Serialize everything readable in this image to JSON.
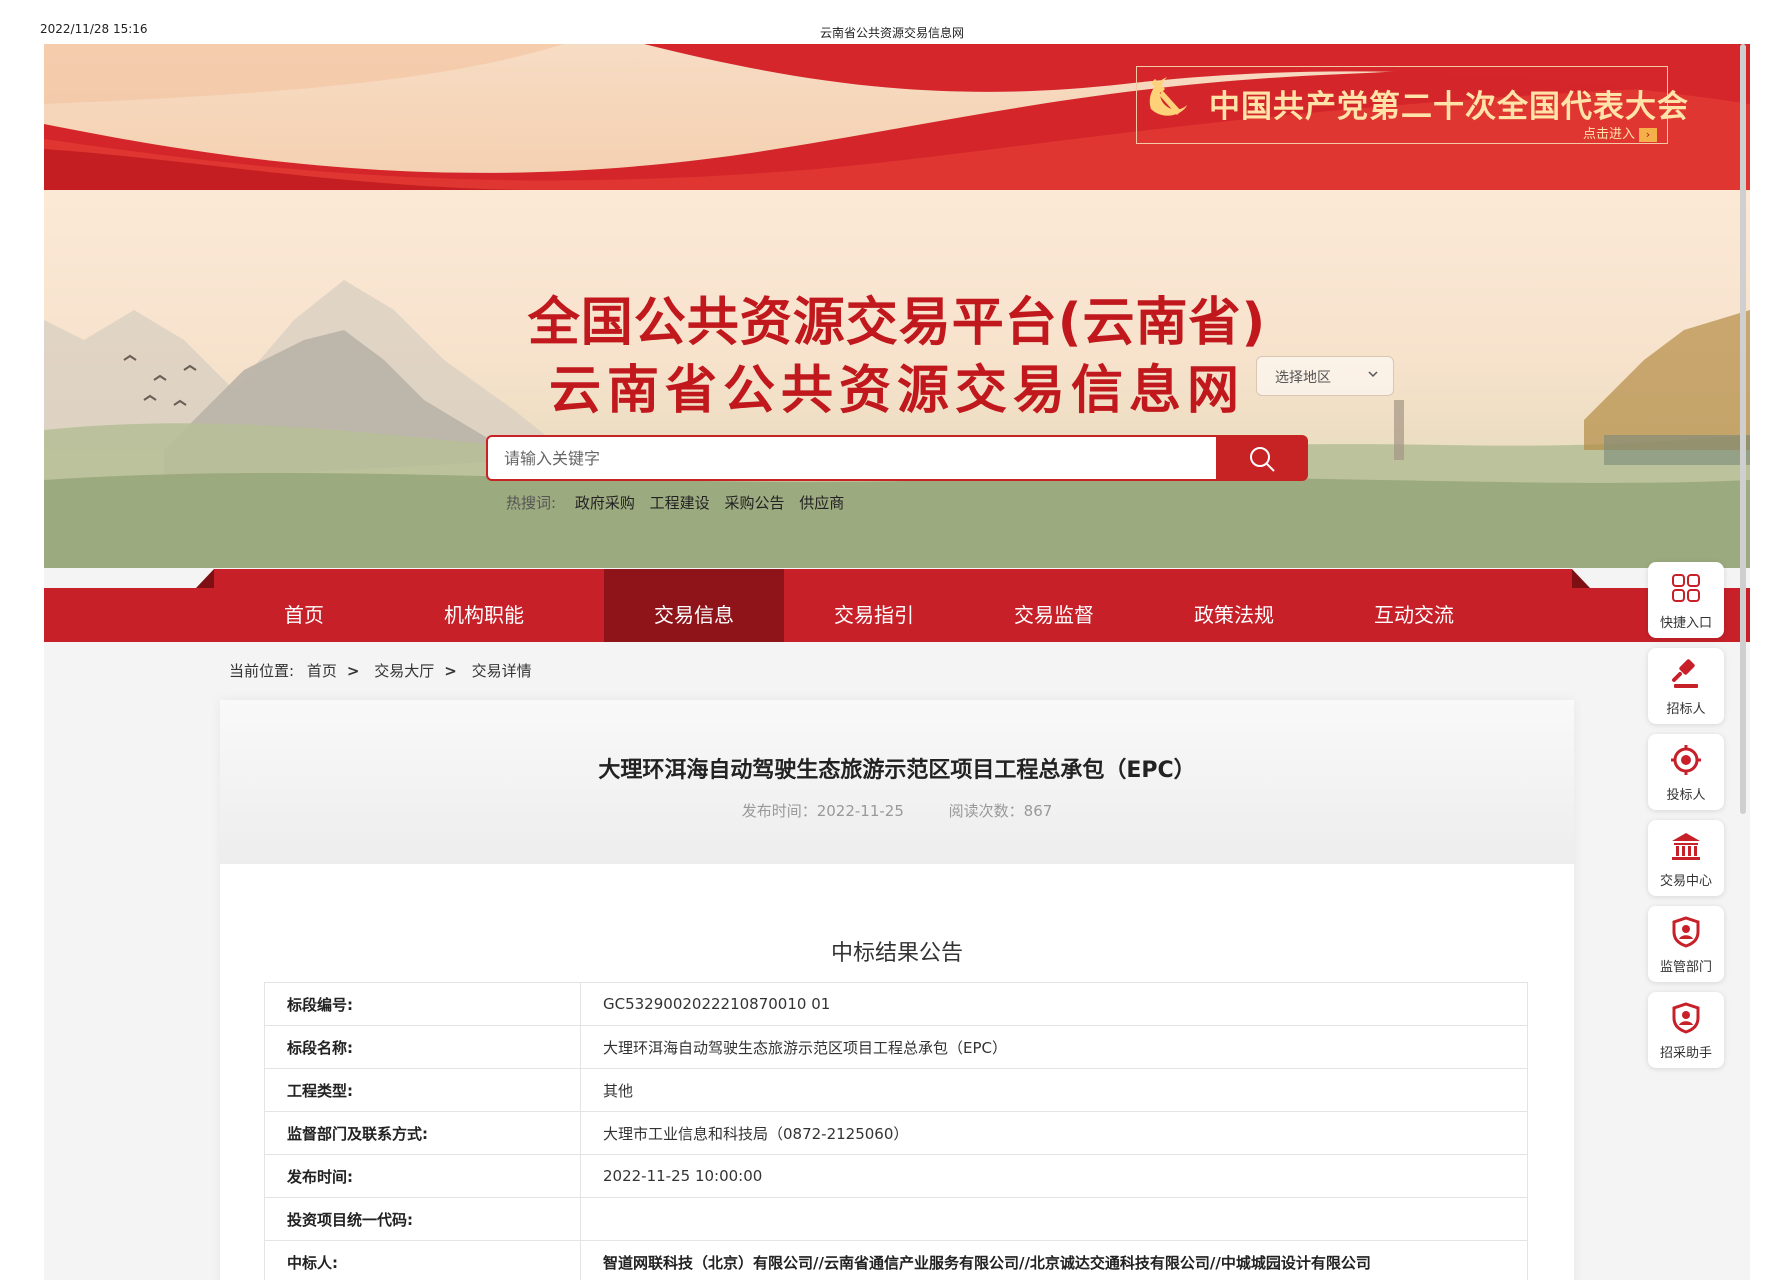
{
  "print_header": {
    "datetime": "2022/11/28 15:16",
    "page_title": "云南省公共资源交易信息网"
  },
  "banner": {
    "congress_text": "中国共产党第二十次全国代表大会",
    "enter_label": "点击进入"
  },
  "header": {
    "title_line1": "全国公共资源交易平台(云南省)",
    "title_line2": "云南省公共资源交易信息网",
    "region_select": "选择地区"
  },
  "search": {
    "placeholder": "请输入关键字",
    "hot_label": "热搜词:",
    "hot_words": [
      "政府采购",
      "工程建设",
      "采购公告",
      "供应商"
    ]
  },
  "nav": {
    "items": [
      "首页",
      "机构职能",
      "交易信息",
      "交易指引",
      "交易监督",
      "政策法规",
      "互动交流"
    ],
    "active_index": 2
  },
  "breadcrumb": {
    "label": "当前位置:",
    "items": [
      "首页",
      "交易大厅",
      "交易详情"
    ]
  },
  "document": {
    "title": "大理环洱海自动驾驶生态旅游示范区项目工程总承包（EPC）",
    "publish_time": "发布时间：2022-11-25",
    "read_count": "阅读次数：867",
    "section_title": "中标结果公告",
    "rows": [
      {
        "key": "标段编号:",
        "value": "GC5329002022210870010 01"
      },
      {
        "key": "标段名称:",
        "value": "大理环洱海自动驾驶生态旅游示范区项目工程总承包（EPC）"
      },
      {
        "key": "工程类型:",
        "value": "其他"
      },
      {
        "key": "监督部门及联系方式:",
        "value": "大理市工业信息和科技局（0872-2125060）"
      },
      {
        "key": "发布时间:",
        "value": "2022-11-25 10:00:00"
      },
      {
        "key": "投资项目统一代码:",
        "value": ""
      },
      {
        "key": "中标人:",
        "value": "智道网联科技（北京）有限公司//云南省通信产业服务有限公司//北京诚达交通科技有限公司//中城城园设计有限公司"
      }
    ]
  },
  "side_toolbar": {
    "items": [
      {
        "label": "快捷入口",
        "icon": "grid-icon"
      },
      {
        "label": "招标人",
        "icon": "gavel-icon"
      },
      {
        "label": "投标人",
        "icon": "target-icon"
      },
      {
        "label": "交易中心",
        "icon": "bank-icon"
      },
      {
        "label": "监管部门",
        "icon": "shield-user-icon"
      },
      {
        "label": "招采助手",
        "icon": "shield-user-icon"
      }
    ]
  },
  "colors": {
    "brand_red": "#c72029",
    "active_nav": "#8e141a",
    "title_red": "#c0181c",
    "banner_gold": "#ffe3a8"
  }
}
